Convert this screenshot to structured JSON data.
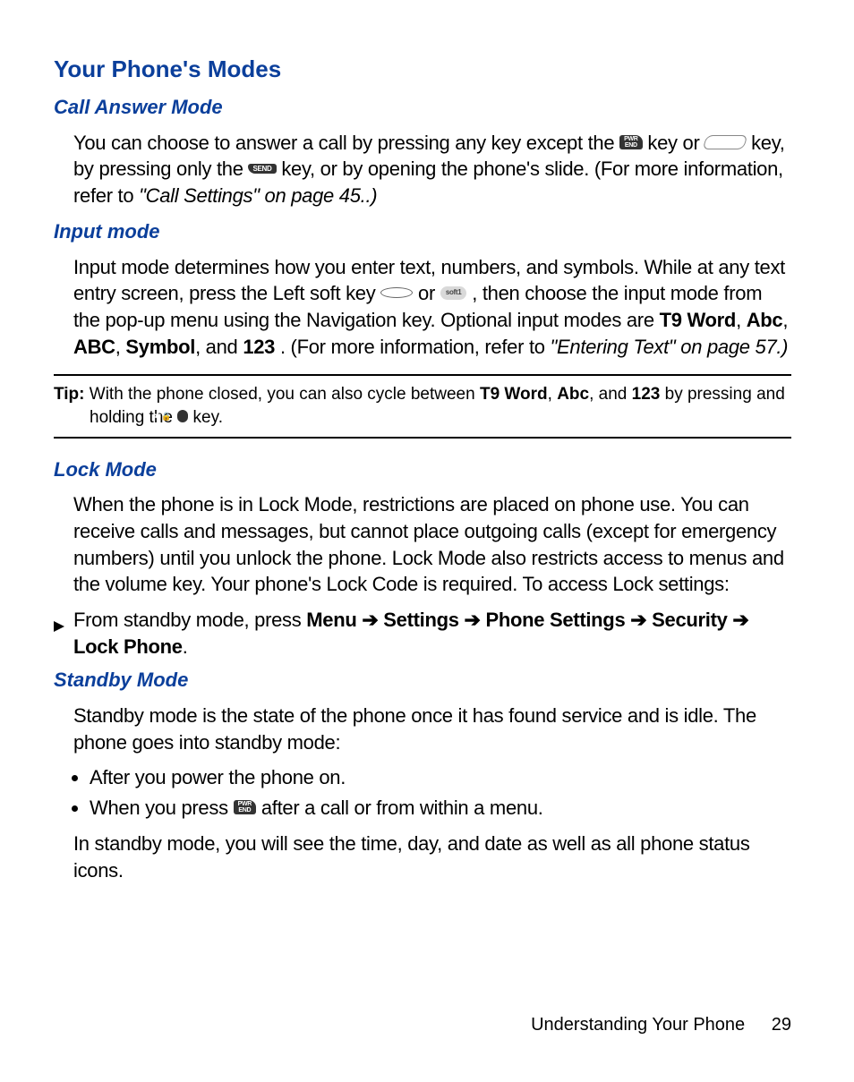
{
  "heading": "Your Phone's Modes",
  "sec1": {
    "title": "Call Answer Mode",
    "p1a": "You can choose to answer a call by pressing any key except the ",
    "p1b": " key or ",
    "p1c": " key, by pressing only the ",
    "p1d": " key, or by opening the phone's slide. (For more information, refer to ",
    "ref": "\"Call Settings\"",
    "p1e": "  on page 45..)"
  },
  "sec2": {
    "title": "Input mode",
    "p1a": "Input mode determines how you enter text, numbers, and symbols. While at any text entry screen, press the Left soft key ",
    "p1b": " or ",
    "p1c": " , then choose the input mode from the pop-up menu using the Navigation key. Optional input modes are ",
    "t9": "T9 Word",
    "abc_m": "Abc",
    "abc_u": "ABC",
    "sym": "Symbol",
    "num": "123",
    "p1d": ". (For more information, refer to ",
    "ref": "\"Entering Text\"",
    "p1e": "  on page 57.)"
  },
  "tip": {
    "label": "Tip:",
    "a": " With the phone closed, you can also cycle between ",
    "t9": "T9 Word",
    "abc": "Abc",
    "num": "123",
    "b": " by pressing and holding the ",
    "c": " key."
  },
  "sec3": {
    "title": "Lock Mode",
    "p1": "When the phone is in Lock Mode, restrictions are placed on phone use. You can receive calls and messages, but cannot place outgoing calls (except for emergency numbers) until you unlock the phone. Lock Mode also restricts access to menus and the volume key. Your phone's Lock Code is required.  To access Lock settings:",
    "step_a": "From standby mode, press ",
    "menu": "Menu",
    "settings": "Settings",
    "phone_settings": "Phone Settings",
    "security": "Security",
    "lock_phone": "Lock Phone",
    "arrow": "➔"
  },
  "sec4": {
    "title": "Standby Mode",
    "p1": "Standby mode is the state of the phone once it has found service and is idle. The phone goes into standby mode:",
    "b1": "After you power the phone on.",
    "b2a": "When you press ",
    "b2b": " after a call or from within a menu.",
    "p2": "In standby mode, you will see the time, day, and date as well as all phone status icons."
  },
  "footer": {
    "title": "Understanding Your Phone",
    "page": "29"
  },
  "icons": {
    "end": "PWR\nEND",
    "send": "SEND",
    "soft1": "soft1",
    "star": "✱ 🔒 ↑"
  }
}
